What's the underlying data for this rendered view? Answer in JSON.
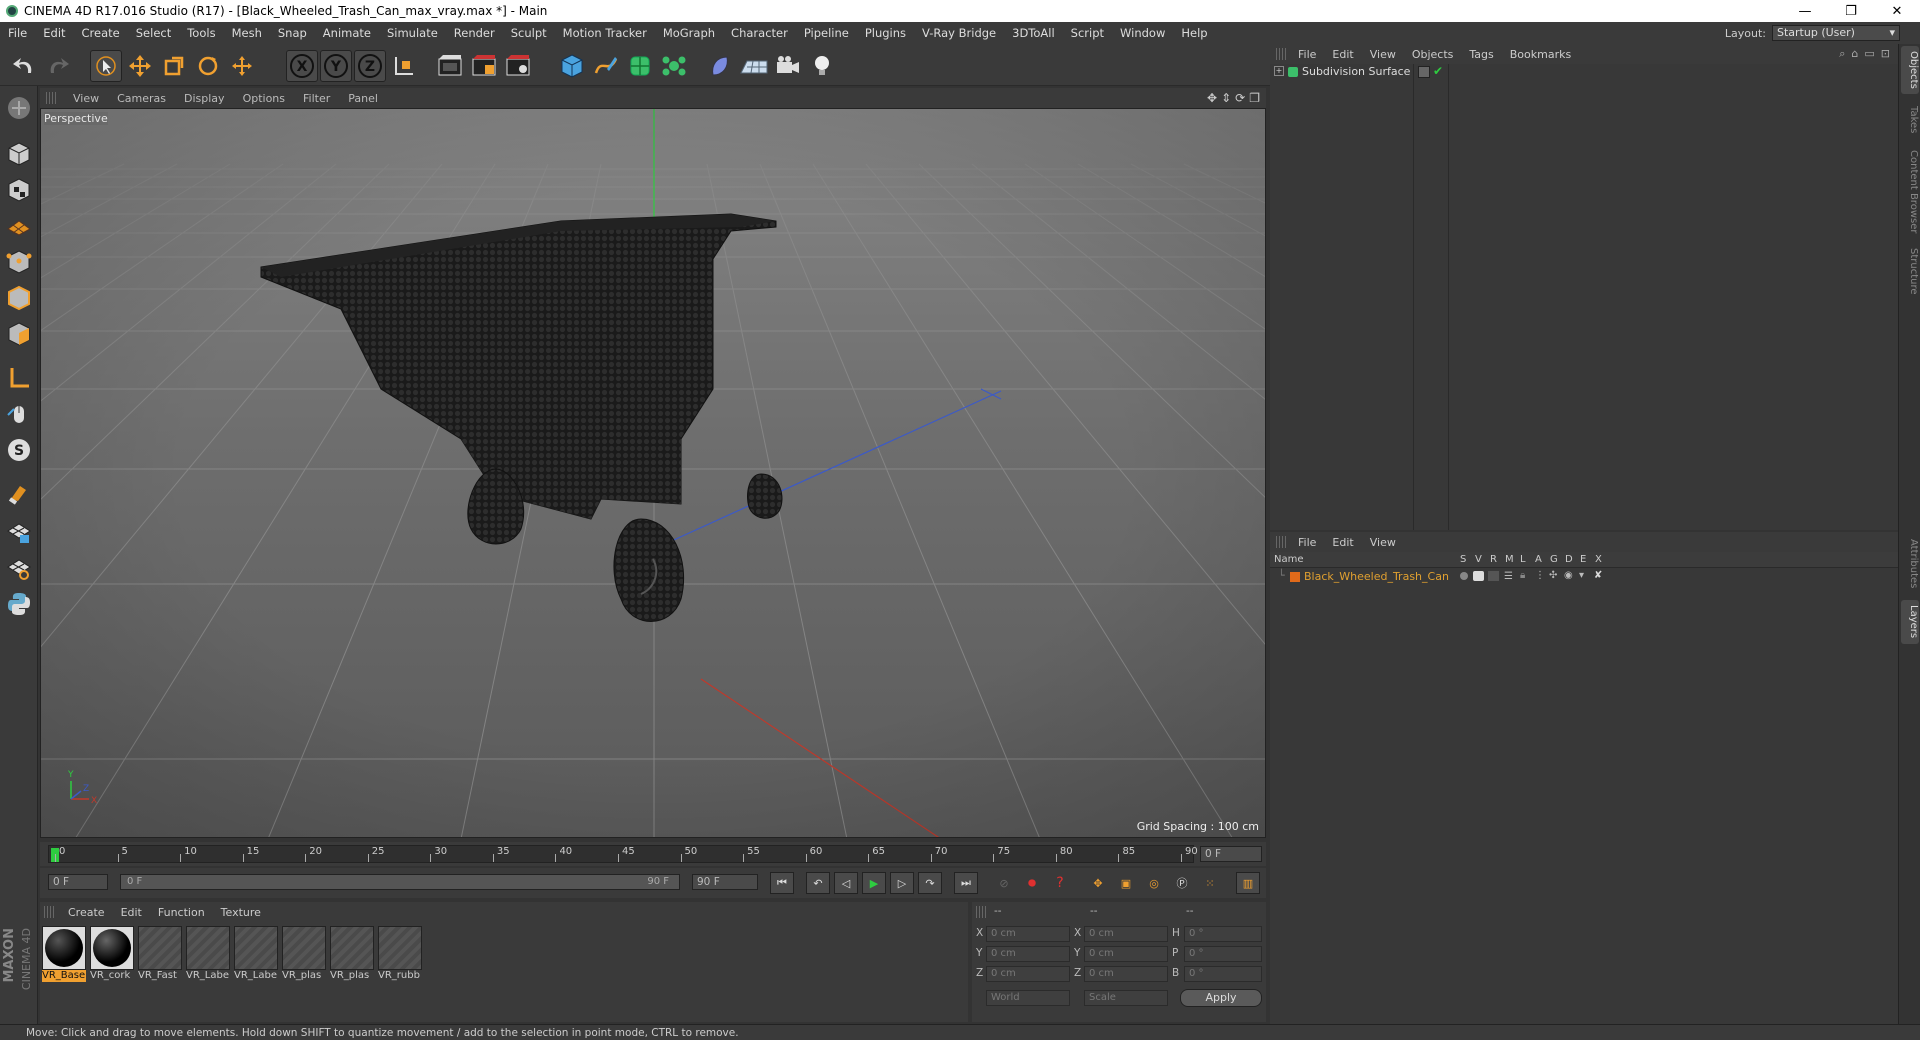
{
  "window": {
    "title": "CINEMA 4D R17.016 Studio (R17) - [Black_Wheeled_Trash_Can_max_vray.max *] - Main",
    "minimize": "—",
    "restore": "❐",
    "close": "✕"
  },
  "menu": [
    "File",
    "Edit",
    "Create",
    "Select",
    "Tools",
    "Mesh",
    "Snap",
    "Animate",
    "Simulate",
    "Render",
    "Sculpt",
    "Motion Tracker",
    "MoGraph",
    "Character",
    "Pipeline",
    "Plugins",
    "V-Ray Bridge",
    "3DToAll",
    "Script",
    "Window",
    "Help"
  ],
  "layout": {
    "label": "Layout:",
    "value": "Startup (User)"
  },
  "viewport": {
    "menu": [
      "View",
      "Cameras",
      "Display",
      "Options",
      "Filter",
      "Panel"
    ],
    "label": "Perspective",
    "grid_spacing": "Grid Spacing : 100 cm"
  },
  "timeline": {
    "ticks": [
      "0",
      "5",
      "10",
      "15",
      "20",
      "25",
      "30",
      "35",
      "40",
      "45",
      "50",
      "55",
      "60",
      "65",
      "70",
      "75",
      "80",
      "85",
      "90"
    ],
    "current_frame": "0 F",
    "start_frame": "0 F",
    "range_start": "0 F",
    "range_end": "90 F",
    "end_frame": "90 F"
  },
  "materials": {
    "menu": [
      "Create",
      "Edit",
      "Function",
      "Texture"
    ],
    "items": [
      {
        "label": "VR_Base",
        "kind": "sphere",
        "selected": true
      },
      {
        "label": "VR_cork",
        "kind": "sphere",
        "selected": false
      },
      {
        "label": "VR_Fast",
        "kind": "flat",
        "selected": false
      },
      {
        "label": "VR_Labe",
        "kind": "flat",
        "selected": false
      },
      {
        "label": "VR_Labe",
        "kind": "flat",
        "selected": false
      },
      {
        "label": "VR_plas",
        "kind": "flat",
        "selected": false
      },
      {
        "label": "VR_plas",
        "kind": "flat",
        "selected": false
      },
      {
        "label": "VR_rubb",
        "kind": "flat",
        "selected": false
      }
    ]
  },
  "coords": {
    "headers": [
      "--",
      "--",
      "--"
    ],
    "rows": [
      {
        "a": "X",
        "av": "0 cm",
        "b": "X",
        "bv": "0 cm",
        "c": "H",
        "cv": "0 °"
      },
      {
        "a": "Y",
        "av": "0 cm",
        "b": "Y",
        "bv": "0 cm",
        "c": "P",
        "cv": "0 °"
      },
      {
        "a": "Z",
        "av": "0 cm",
        "b": "Z",
        "bv": "0 cm",
        "c": "B",
        "cv": "0 °"
      }
    ],
    "world": "World",
    "scale": "Scale",
    "apply": "Apply"
  },
  "objects": {
    "menu": [
      "File",
      "Edit",
      "View",
      "Objects",
      "Tags",
      "Bookmarks"
    ],
    "items": [
      {
        "name": "Subdivision Surface"
      }
    ]
  },
  "layers": {
    "menu": [
      "File",
      "Edit",
      "View"
    ],
    "columns": [
      "Name",
      "S",
      "V",
      "R",
      "M",
      "L",
      "A",
      "G",
      "D",
      "E",
      "X"
    ],
    "items": [
      {
        "name": "Black_Wheeled_Trash_Can",
        "color": "#e06a1a"
      }
    ]
  },
  "sidetabs": [
    "Objects",
    "Takes",
    "Content Browser",
    "Structure",
    "Attributes",
    "Layers"
  ],
  "status": "Move: Click and drag to move elements. Hold down SHIFT to quantize movement / add to the selection in point mode, CTRL to remove.",
  "brand": {
    "maxon": "MAXON",
    "c4d": "CINEMA 4D"
  },
  "colors": {
    "accent": "#f0a030",
    "active_frame": "#2ecc40",
    "axis_x": "#c0392b",
    "axis_y": "#2ecc40",
    "axis_z": "#3c5ac8",
    "layer_text": "#e0a030"
  }
}
